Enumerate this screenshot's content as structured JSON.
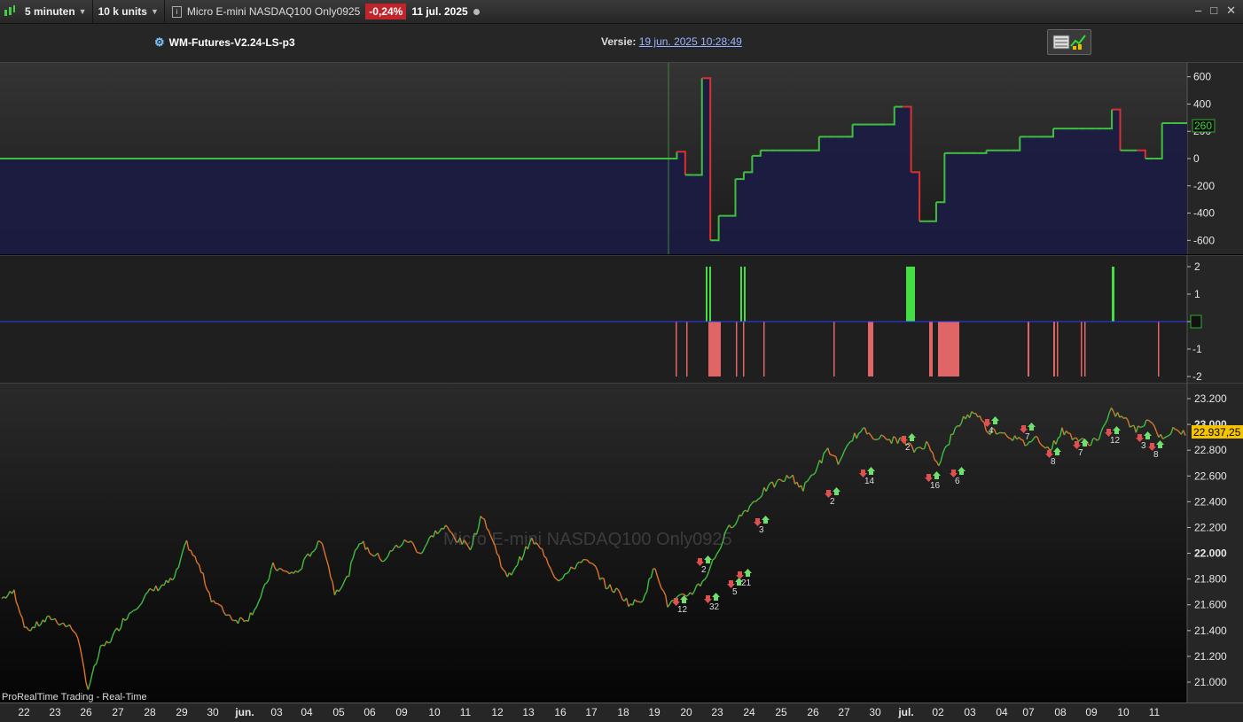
{
  "toolbar": {
    "timeframe": "5 minuten",
    "units": "10 k units",
    "instrument": "Micro E-mini NASDAQ100 Only0925",
    "change": "-0,24%",
    "date": "11 jul. 2025"
  },
  "header": {
    "strategy": "WM-Futures-V2.24-LS-p3",
    "version_label": "Versie:",
    "version_date": "19 jun. 2025 10:28:49"
  },
  "equity_panel": {
    "y_ticks": [
      "600",
      "400",
      "200",
      "0",
      "-200",
      "-400",
      "-600"
    ],
    "last_value": "260"
  },
  "position_panel": {
    "y_ticks": [
      "2",
      "1",
      "0",
      "-1",
      "-2"
    ]
  },
  "price_panel": {
    "y_ticks": [
      "23.200",
      "23.000",
      "22.800",
      "22.600",
      "22.400",
      "22.200",
      "22.000",
      "21.800",
      "21.600",
      "21.400",
      "21.200",
      "21.000"
    ],
    "last_price": "22.937,25",
    "watermark": "Micro E-mini NASDAQ100 Only0925",
    "footer": "ProRealTime Trading - Real-Time",
    "trade_labels": [
      "12",
      "32",
      "2",
      "5",
      "21",
      "3",
      "2",
      "14",
      "2",
      "16",
      "6",
      "4",
      "7",
      "8",
      "7",
      "12",
      "3",
      "8"
    ]
  },
  "x_axis": [
    "22",
    "23",
    "26",
    "27",
    "28",
    "29",
    "30",
    "jun.",
    "03",
    "04",
    "05",
    "06",
    "09",
    "10",
    "11",
    "12",
    "13",
    "16",
    "17",
    "18",
    "19",
    "20",
    "23",
    "24",
    "25",
    "26",
    "27",
    "30",
    "jul.",
    "02",
    "03",
    "04",
    "07",
    "08",
    "09",
    "10",
    "11"
  ],
  "colors": {
    "profit_green": "#3fbf3f",
    "loss_red": "#d93030",
    "short_bar": "#e06666",
    "long_bar": "#44dd44",
    "last_price_bg": "#f5c400"
  },
  "chart_data": [
    {
      "type": "line",
      "title": "",
      "series": [
        {
          "values": [
            0,
            0,
            0,
            0,
            0,
            50,
            -120,
            -120,
            590,
            -600,
            -420,
            -420,
            -150,
            -100,
            20,
            60,
            60,
            60,
            60,
            60,
            60,
            60,
            160,
            160,
            160,
            160,
            250,
            250,
            250,
            250,
            250,
            380,
            380,
            -100,
            -460,
            -460,
            -320,
            40,
            40,
            40,
            40,
            40,
            60,
            60,
            60,
            60,
            160,
            160,
            160,
            160,
            220,
            220,
            220,
            220,
            220,
            220,
            220,
            360,
            60,
            60,
            60,
            0,
            0,
            260,
            260,
            260,
            260
          ]
        }
      ],
      "ylim": [
        -650,
        650
      ],
      "grid": false
    },
    {
      "type": "bar",
      "title": "",
      "values_description_from_axis": "position size",
      "ylim": [
        -2,
        2
      ]
    },
    {
      "type": "line",
      "title": "",
      "series": [
        {
          "values": [
            21650,
            21700,
            21400,
            21450,
            21500,
            21450,
            21400,
            20950,
            21250,
            21350,
            21500,
            21600,
            21700,
            21750,
            21800,
            22080,
            21900,
            21650,
            21550,
            21480,
            21500,
            21650,
            21900,
            21850,
            21850,
            22000,
            22100,
            21700,
            21800,
            22100,
            22000,
            21950,
            22050,
            22100,
            22000,
            22150,
            22200,
            22100,
            22050,
            22300,
            22050,
            21800,
            21950,
            22100,
            22000,
            21800,
            21850,
            21950,
            21900,
            21750,
            21700,
            21600,
            21650,
            21900,
            21600,
            21650,
            21700,
            21800,
            22000,
            22200,
            22300,
            22400,
            22500,
            22550,
            22600,
            22500,
            22650,
            22800,
            22700,
            22900,
            22950,
            22900,
            22880,
            22880,
            22800,
            22850,
            22700,
            22900,
            23050,
            23100,
            22950,
            22950,
            22900,
            22850,
            22900,
            22800,
            22950,
            22900,
            22850,
            22900,
            23100,
            23050,
            22950,
            23050,
            22900,
            22950,
            22937
          ]
        }
      ],
      "ylim": [
        20950,
        23250
      ],
      "grid": false
    }
  ]
}
